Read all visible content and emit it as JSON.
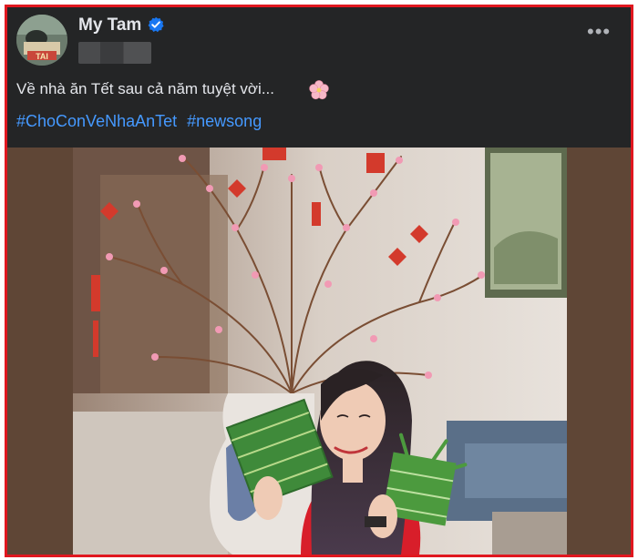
{
  "post": {
    "author_name": "My Tam",
    "verified": true,
    "caption": "Về nhà ăn Tết sau cả năm tuyệt vời...",
    "caption_emoji": "cherry-blossom-icon",
    "hashtags": [
      "#ChoConVeNhaAnTet",
      "#newsong"
    ],
    "more_options": "•••",
    "avatar_text": "TAI"
  },
  "colors": {
    "background": "#242526",
    "text": "#e4e6eb",
    "hashtag": "#4599ff",
    "verified_badge": "#1877f2",
    "border": "#e0171f"
  }
}
